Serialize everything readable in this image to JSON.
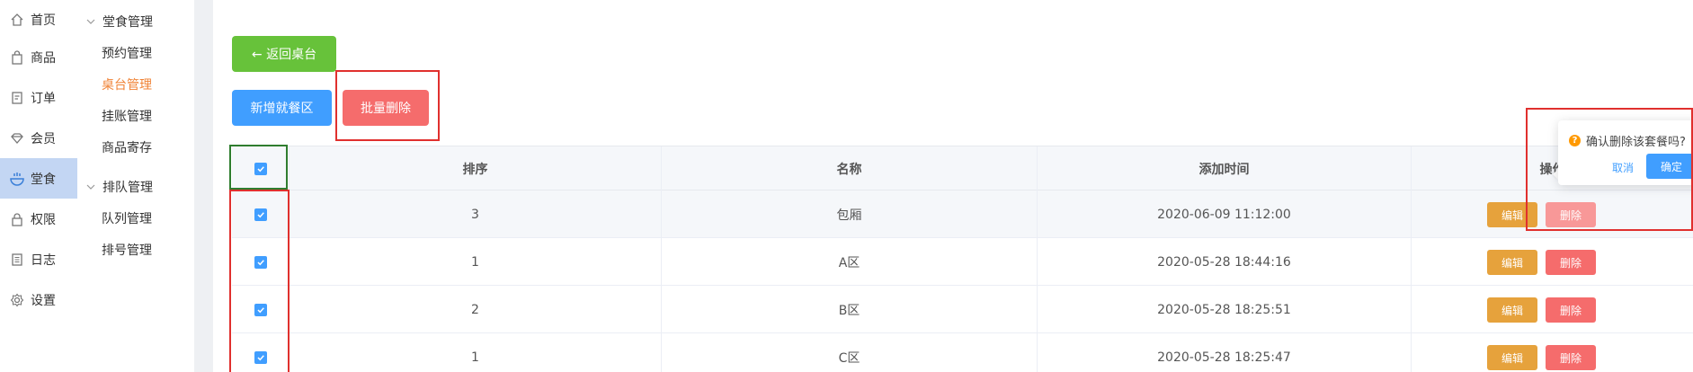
{
  "nav": {
    "items": [
      {
        "label": "首页",
        "icon": "home-icon"
      },
      {
        "label": "商品",
        "icon": "shopping-bag-icon"
      },
      {
        "label": "订单",
        "icon": "document-icon"
      },
      {
        "label": "会员",
        "icon": "diamond-icon"
      },
      {
        "label": "堂食",
        "icon": "dining-icon"
      },
      {
        "label": "权限",
        "icon": "lock-icon"
      },
      {
        "label": "日志",
        "icon": "log-icon"
      },
      {
        "label": "设置",
        "icon": "gear-icon"
      }
    ],
    "active": "堂食"
  },
  "submenu": {
    "groups": [
      {
        "title": "堂食管理",
        "items": [
          "预约管理",
          "桌台管理",
          "挂账管理",
          "商品寄存"
        ]
      },
      {
        "title": "排队管理",
        "items": [
          "队列管理",
          "排号管理"
        ]
      }
    ],
    "active_item": "桌台管理"
  },
  "toolbar": {
    "back_label": "← 返回桌台",
    "add_label": "新增就餐区",
    "batch_delete_label": "批量删除"
  },
  "table": {
    "columns": [
      "排序",
      "名称",
      "添加时间",
      "操作"
    ],
    "rows": [
      {
        "order": "3",
        "name": "包厢",
        "time": "2020-06-09 11:12:00"
      },
      {
        "order": "1",
        "name": "A区",
        "time": "2020-05-28 18:44:16"
      },
      {
        "order": "2",
        "name": "B区",
        "time": "2020-05-28 18:25:51"
      },
      {
        "order": "1",
        "name": "C区",
        "time": "2020-05-28 18:25:47"
      }
    ],
    "edit_label": "编辑",
    "delete_label": "删除"
  },
  "popconfirm": {
    "message": "确认删除该套餐吗?",
    "cancel": "取消",
    "confirm": "确定"
  },
  "colors": {
    "primary": "#409eff",
    "success": "#67c23a",
    "danger": "#f56c6c",
    "warning": "#e6a23c",
    "active_menu": "#f08336",
    "highlight_red": "#e0302e",
    "highlight_green": "#2f7d2f"
  }
}
